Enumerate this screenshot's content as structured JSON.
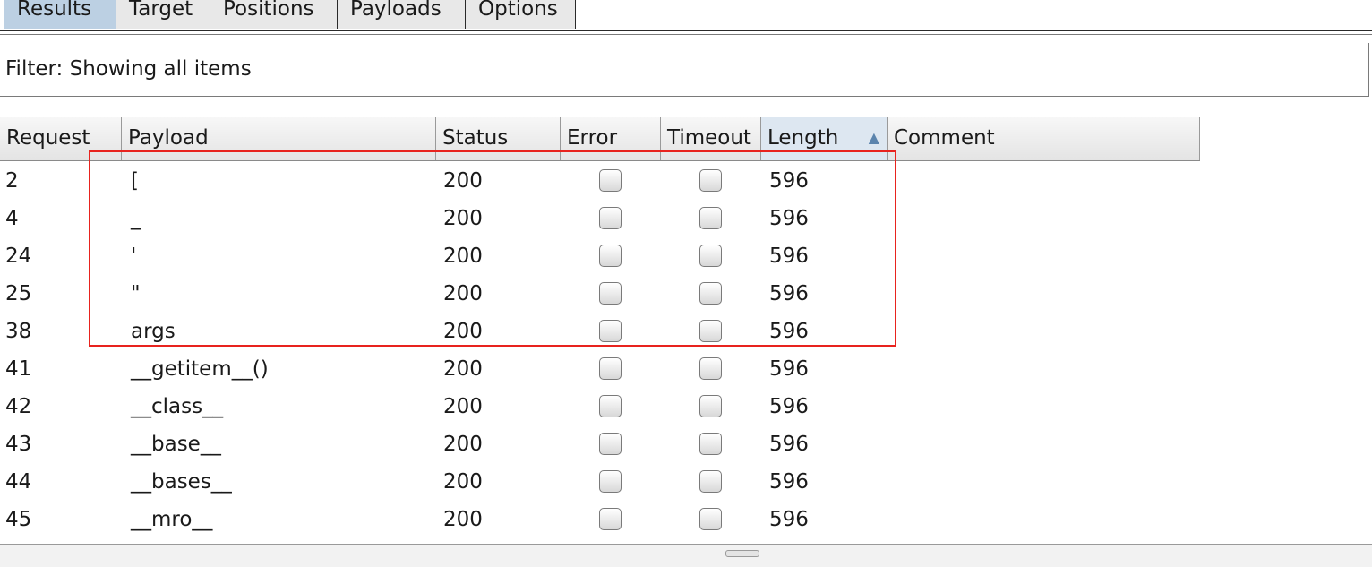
{
  "tabs": [
    {
      "label": "Results",
      "active": true
    },
    {
      "label": "Target",
      "active": false
    },
    {
      "label": "Positions",
      "active": false
    },
    {
      "label": "Payloads",
      "active": false
    },
    {
      "label": "Options",
      "active": false
    }
  ],
  "filter": {
    "text": "Filter: Showing all items"
  },
  "table": {
    "columns": [
      "Request",
      "Payload",
      "Status",
      "Error",
      "Timeout",
      "Length",
      "Comment"
    ],
    "sorted_column": "Length",
    "sort_direction": "ascending",
    "rows": [
      {
        "request": "2",
        "payload": "[",
        "status": "200",
        "error": false,
        "timeout": false,
        "length": "596",
        "comment": ""
      },
      {
        "request": "4",
        "payload": "_",
        "status": "200",
        "error": false,
        "timeout": false,
        "length": "596",
        "comment": ""
      },
      {
        "request": "24",
        "payload": "'",
        "status": "200",
        "error": false,
        "timeout": false,
        "length": "596",
        "comment": ""
      },
      {
        "request": "25",
        "payload": "\"",
        "status": "200",
        "error": false,
        "timeout": false,
        "length": "596",
        "comment": ""
      },
      {
        "request": "38",
        "payload": "args",
        "status": "200",
        "error": false,
        "timeout": false,
        "length": "596",
        "comment": ""
      },
      {
        "request": "41",
        "payload": "__getitem__()",
        "status": "200",
        "error": false,
        "timeout": false,
        "length": "596",
        "comment": ""
      },
      {
        "request": "42",
        "payload": "__class__",
        "status": "200",
        "error": false,
        "timeout": false,
        "length": "596",
        "comment": ""
      },
      {
        "request": "43",
        "payload": "__base__",
        "status": "200",
        "error": false,
        "timeout": false,
        "length": "596",
        "comment": ""
      },
      {
        "request": "44",
        "payload": "__bases__",
        "status": "200",
        "error": false,
        "timeout": false,
        "length": "596",
        "comment": ""
      },
      {
        "request": "45",
        "payload": "__mro__",
        "status": "200",
        "error": false,
        "timeout": false,
        "length": "596",
        "comment": ""
      }
    ]
  },
  "highlight": {
    "color": "#e8231e"
  },
  "icons": {
    "sort": "sort-ascending-icon"
  }
}
